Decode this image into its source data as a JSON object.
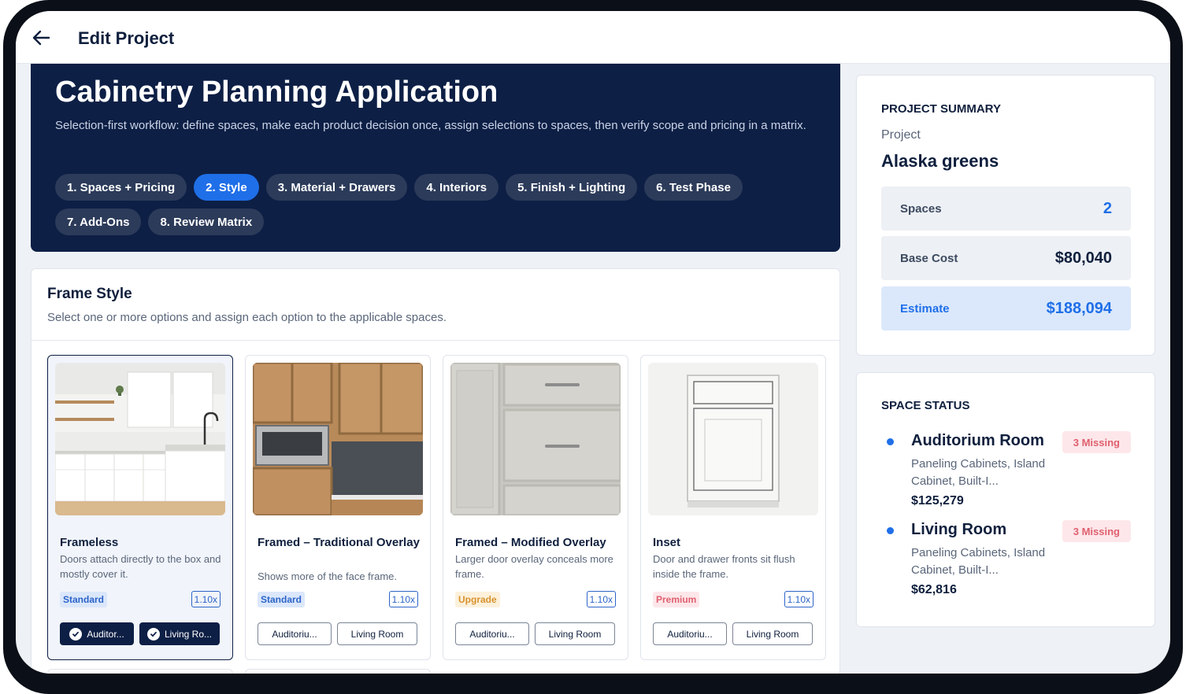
{
  "topbar": {
    "title": "Edit Project",
    "back_icon": "arrow-left-icon"
  },
  "hero": {
    "title": "Cabinetry Planning Application",
    "subtitle": "Selection-first workflow: define spaces, make each product decision once, assign selections to spaces, then verify scope and pricing in a matrix.",
    "steps": [
      {
        "label": "1. Spaces + Pricing",
        "active": false
      },
      {
        "label": "2. Style",
        "active": true
      },
      {
        "label": "3. Material + Drawers",
        "active": false
      },
      {
        "label": "4. Interiors",
        "active": false
      },
      {
        "label": "5. Finish + Lighting",
        "active": false
      },
      {
        "label": "6. Test Phase",
        "active": false
      },
      {
        "label": "7. Add-Ons",
        "active": false
      },
      {
        "label": "8. Review Matrix",
        "active": false
      }
    ]
  },
  "frame_style": {
    "title": "Frame Style",
    "subtitle": "Select one or more options and assign each option to the applicable spaces.",
    "options": [
      {
        "name": "Frameless",
        "description": "Doors attach directly to the box and mostly cover it.",
        "tier": "Standard",
        "multiplier": "1.10x",
        "selected": true,
        "spaces": [
          "Auditor...",
          "Living Ro..."
        ]
      },
      {
        "name": "Framed – Traditional Overlay",
        "description": "Shows more of the face frame.",
        "tier": "Standard",
        "multiplier": "1.10x",
        "selected": false,
        "spaces": [
          "Auditoriu...",
          "Living Room"
        ]
      },
      {
        "name": "Framed – Modified Overlay",
        "description": "Larger door overlay conceals more frame.",
        "tier": "Upgrade",
        "multiplier": "1.10x",
        "selected": false,
        "spaces": [
          "Auditoriu...",
          "Living Room"
        ]
      },
      {
        "name": "Inset",
        "description": "Door and drawer fronts sit flush inside the frame.",
        "tier": "Premium",
        "multiplier": "1.10x",
        "selected": false,
        "spaces": [
          "Auditoriu...",
          "Living Room"
        ]
      }
    ]
  },
  "summary": {
    "heading": "PROJECT SUMMARY",
    "project_label": "Project",
    "project_name": "Alaska greens",
    "spaces_label": "Spaces",
    "spaces_value": "2",
    "base_label": "Base Cost",
    "base_value": "$80,040",
    "estimate_label": "Estimate",
    "estimate_value": "$188,094"
  },
  "space_status": {
    "heading": "SPACE STATUS",
    "rooms": [
      {
        "name": "Auditorium Room",
        "badge": "3 Missing",
        "detail": "Paneling Cabinets, Island Cabinet, Built-I...",
        "cost": "$125,279"
      },
      {
        "name": "Living Room",
        "badge": "3 Missing",
        "detail": "Paneling Cabinets, Island Cabinet, Built-I...",
        "cost": "$62,816"
      }
    ]
  },
  "colors": {
    "navy": "#0d1f45",
    "accent": "#1f6fe8",
    "missing": "#e0606f",
    "upgrade": "#d8922d"
  }
}
